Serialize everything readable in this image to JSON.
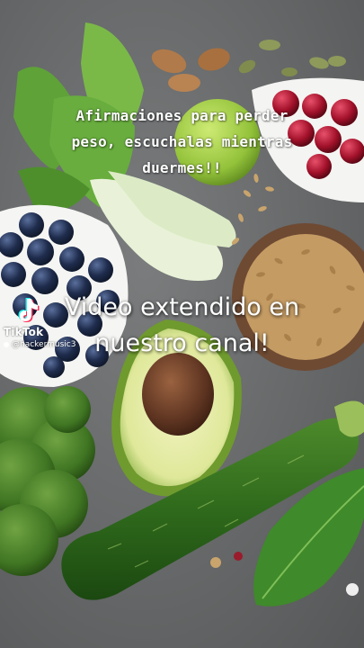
{
  "caption": {
    "line1": "Afirmaciones para perder",
    "line2": "peso, escuchalas mientras",
    "line3": "duermes!!"
  },
  "overlay_text": {
    "line1": "Video extendido en",
    "line2": "nuestro canal!"
  },
  "watermark": {
    "platform": "TikTok",
    "username": "@hackermusic3"
  },
  "colors": {
    "background": "#6b6d6e",
    "text": "#ffffff"
  }
}
